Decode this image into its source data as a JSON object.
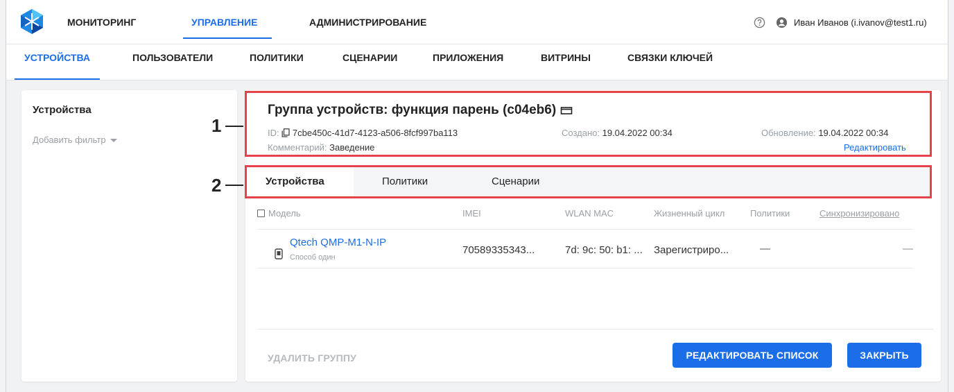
{
  "topnav": {
    "items": [
      {
        "label": "МОНИТОРИНГ",
        "active": false
      },
      {
        "label": "УПРАВЛЕНИЕ",
        "active": true
      },
      {
        "label": "АДМИНИСТРИРОВАНИЕ",
        "active": false
      }
    ],
    "user": "Иван Иванов (i.ivanov@test1.ru)"
  },
  "subnav": {
    "items": [
      {
        "label": "УСТРОЙСТВА",
        "active": true
      },
      {
        "label": "ПОЛЬЗОВАТЕЛИ",
        "active": false
      },
      {
        "label": "ПОЛИТИКИ",
        "active": false
      },
      {
        "label": "СЦЕНАРИИ",
        "active": false
      },
      {
        "label": "ПРИЛОЖЕНИЯ",
        "active": false
      },
      {
        "label": "ВИТРИНЫ",
        "active": false
      },
      {
        "label": "СВЯЗКИ КЛЮЧЕЙ",
        "active": false
      }
    ]
  },
  "sidebar": {
    "title": "Устройства",
    "filter_label": "Добавить фильтр"
  },
  "group": {
    "title": "Группа устройств: функция парень (c04eb6)",
    "id_label": "ID:",
    "id_value": "7cbe450c-41d7-4123-a506-8fcf997ba113",
    "created_label": "Создано:",
    "created_value": "19.04.2022 00:34",
    "updated_label": "Обновление:",
    "updated_value": "19.04.2022 00:34",
    "comment_label": "Комментарий:",
    "comment_value": "Заведение",
    "edit_link": "Редактировать"
  },
  "annotations": {
    "marker1": "1",
    "marker2": "2"
  },
  "tabs": [
    {
      "label": "Устройства",
      "active": true
    },
    {
      "label": "Политики",
      "active": false
    },
    {
      "label": "Сценарии",
      "active": false
    }
  ],
  "table": {
    "headers": [
      "Модель",
      "IMEI",
      "WLAN MAC",
      "Жизненный цикл",
      "Политики",
      "Синхронизировано"
    ],
    "rows": [
      {
        "model": "Qtech QMP-M1-N-IP",
        "model_sub": "Способ один",
        "imei": "70589335343...",
        "wlan": "7d: 9c: 50: b1: ...",
        "lifecycle": "Зарегистриро...",
        "policies": "—",
        "synced": "—"
      }
    ]
  },
  "footer": {
    "delete_label": "УДАЛИТЬ ГРУППУ",
    "edit_list_label": "РЕДАКТИРОВАТЬ СПИСОК",
    "close_label": "ЗАКРЫТЬ"
  },
  "colors": {
    "accent": "#1c6ee8",
    "annotation": "#e5424b"
  }
}
